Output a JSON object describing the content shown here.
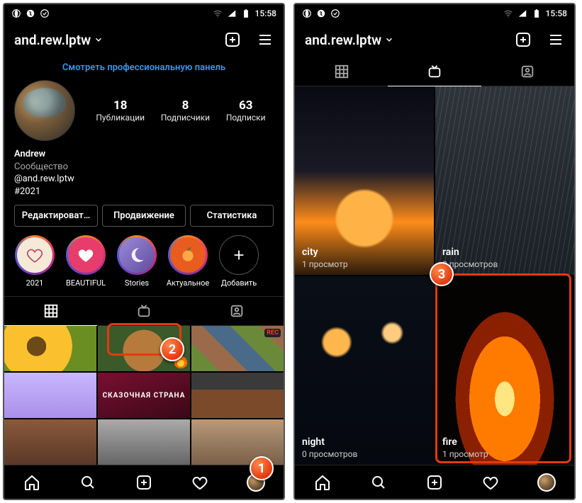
{
  "status": {
    "time": "15:58"
  },
  "header": {
    "username": "and.rew.lptw"
  },
  "pro_link": "Смотреть профессиональную панель",
  "stats": {
    "posts": {
      "num": "18",
      "label": "Публикации"
    },
    "followers": {
      "num": "8",
      "label": "Подписчики"
    },
    "following": {
      "num": "63",
      "label": "Подписки"
    }
  },
  "bio": {
    "name": "Andrew",
    "community": "Сообщество",
    "mention": "@and.rew.lptw",
    "hashtag": "#2021"
  },
  "actions": {
    "edit": "Редактироват…",
    "promo": "Продвижение",
    "stats": "Статистика"
  },
  "highlights": [
    {
      "label": "2021"
    },
    {
      "label": "BEAUTIFUL"
    },
    {
      "label": "Stories"
    },
    {
      "label": "Актуальное"
    }
  ],
  "highlight_add": "Добавить",
  "post_labels": {
    "fairy": "СКАЗОЧНАЯ СТРАНА",
    "rec": "REC"
  },
  "igtv": [
    {
      "title": "city",
      "views": "1 просмотр"
    },
    {
      "title": "rain",
      "views": "0 просмотров"
    },
    {
      "title": "night",
      "views": "0 просмотров"
    },
    {
      "title": "fire",
      "views": "1 просмотр"
    }
  ],
  "callouts": {
    "c1": "1",
    "c2": "2",
    "c3": "3"
  }
}
